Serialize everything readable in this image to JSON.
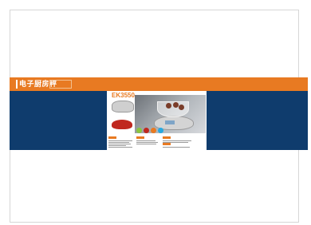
{
  "section": {
    "title": "电子厨房秤"
  },
  "product": {
    "model": "EK3550"
  },
  "colors": {
    "orange": "#e87a22",
    "navy": "#0f3c6d",
    "swatches": [
      "#8cc63f",
      "#c0281f",
      "#e87a22",
      "#29a9e0"
    ]
  }
}
